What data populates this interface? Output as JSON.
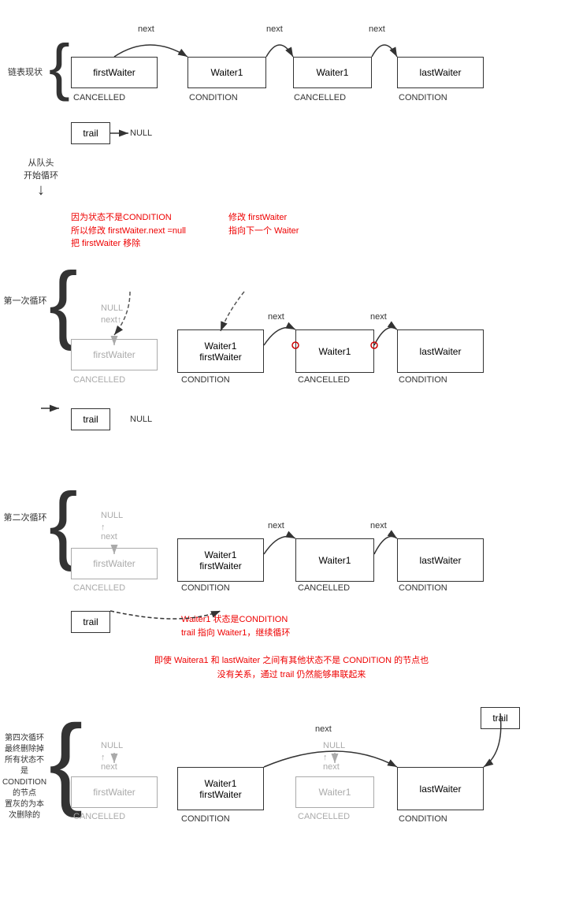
{
  "sections": {
    "section1_label": "链表现状",
    "section2_label": "从队头\n开始循环",
    "section3_label": "第一次循环",
    "section4_label": "第二次循环",
    "section5_label": "第四次循环\n最终删除掉\n所有状态不\n是\nCONDITION\n的节点\n置灰的为本\n次删除的"
  },
  "nodes": {
    "firstWaiter": "firstWaiter",
    "waiter1": "Waiter1",
    "lastWaiter": "lastWaiter",
    "waiter1firstWaiter": "Waiter1\nfirstWaiter",
    "trail": "trail",
    "null_text": "NULL"
  },
  "labels": {
    "cancelled": "CANCELLED",
    "condition": "CONDITION",
    "next": "next",
    "null": "NULL"
  },
  "annotations": {
    "ann1": "因为状态不是CONDITION\n所以修改 firstWaiter.next =null\n把 firstWaiter 移除",
    "ann2": "修改 firstWaiter\n指向下一个 Waiter",
    "ann3": "Waiter1 状态是CONDITION\ntrail 指向 Waiter1，继续循环",
    "ann4": "即使 Waitera1 和 lastWaiter 之间有其他状态不是 CONDITION 的节点也\n没有关系，通过 trail 仍然能够串联起来"
  }
}
